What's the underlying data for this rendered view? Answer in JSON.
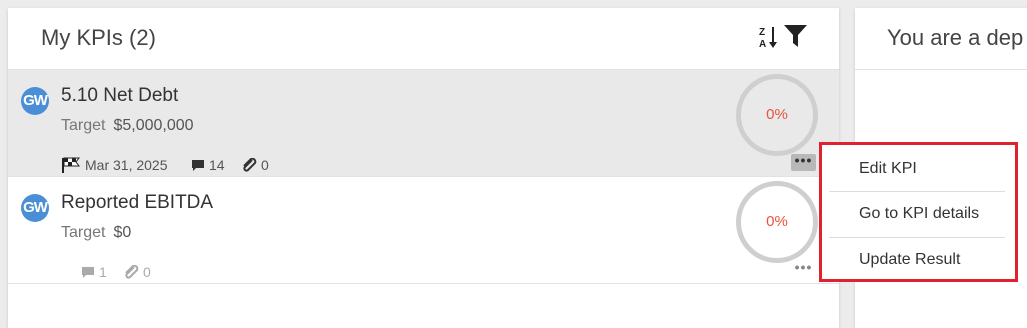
{
  "kpi_panel": {
    "title": "My KPIs (2)",
    "sort_icon": "sort-z-a-icon",
    "filter_icon": "filter-icon"
  },
  "right_panel": {
    "title": "You are a dep"
  },
  "kpis": [
    {
      "avatar_initials": "GW",
      "name": "5.10 Net Debt",
      "target_label": "Target",
      "target_value": "$5,000,000",
      "due_date": "Mar 31, 2025",
      "comments": "14",
      "attachments": "0",
      "progress": "0%"
    },
    {
      "avatar_initials": "GW",
      "name": "Reported EBITDA",
      "target_label": "Target",
      "target_value": "$0",
      "comments": "1",
      "attachments": "0",
      "progress": "0%"
    }
  ],
  "more_label": "•••",
  "context_menu": {
    "items": [
      "Edit KPI",
      "Go to KPI details",
      "Update Result"
    ]
  },
  "colors": {
    "avatar": "#4a8fd6",
    "progress_text": "#e8543c",
    "menu_highlight_border": "#e0212e"
  }
}
